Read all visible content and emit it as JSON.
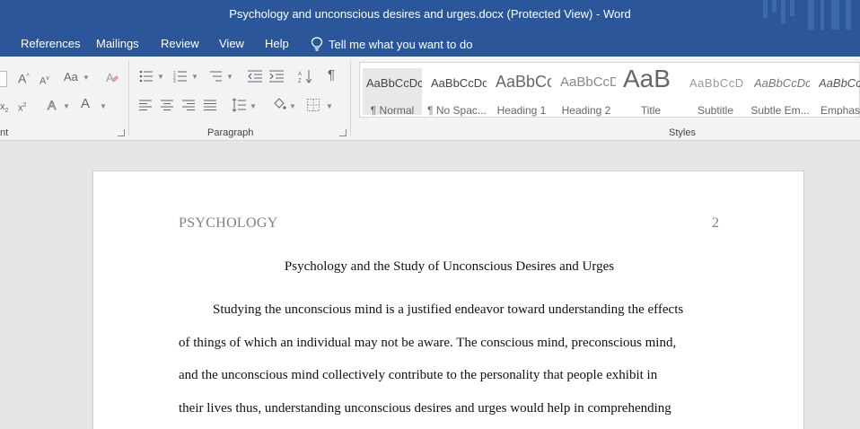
{
  "window": {
    "title": "Psychology and unconscious desires and urges.docx (Protected View)  -  Word"
  },
  "tabs": [
    "References",
    "Mailings",
    "Review",
    "View",
    "Help"
  ],
  "tell_me": "Tell me what you want to do",
  "ribbon": {
    "font_group_label_partial": "nt",
    "paragraph_group_label": "Paragraph",
    "styles_group_label": "Styles",
    "font_controls": {
      "case_label": "Aa",
      "grow_label": "A",
      "shrink_label": "A",
      "color_label": "A"
    },
    "styles": [
      {
        "preview": "AaBbCcDc",
        "label": "¶ Normal"
      },
      {
        "preview": "AaBbCcDc",
        "label": "¶ No Spac..."
      },
      {
        "preview": "AaBbCc",
        "label": "Heading 1"
      },
      {
        "preview": "AaBbCcD",
        "label": "Heading 2"
      },
      {
        "preview": "AaB",
        "label": "Title"
      },
      {
        "preview": "AaBbCcD",
        "label": "Subtitle"
      },
      {
        "preview": "AaBbCcDc",
        "label": "Subtle Em..."
      },
      {
        "preview": "AaBbCcDc",
        "label": "Emphasis"
      }
    ]
  },
  "document": {
    "running_head": "PSYCHOLOGY",
    "page_number": "2",
    "title": "Psychology and the Study of Unconscious Desires and Urges",
    "lines": [
      "Studying the unconscious mind is a justified endeavor toward understanding the effects",
      "of things of which an individual may not be aware. The conscious mind, preconscious mind,",
      "and the unconscious mind collectively contribute to the personality that people exhibit in",
      "their lives thus, understanding unconscious desires and urges would help in comprehending"
    ]
  },
  "colors": {
    "title_bar": "#2b579a",
    "ribbon_bg": "#f3f3f3",
    "canvas_bg": "#e6e6e6"
  }
}
